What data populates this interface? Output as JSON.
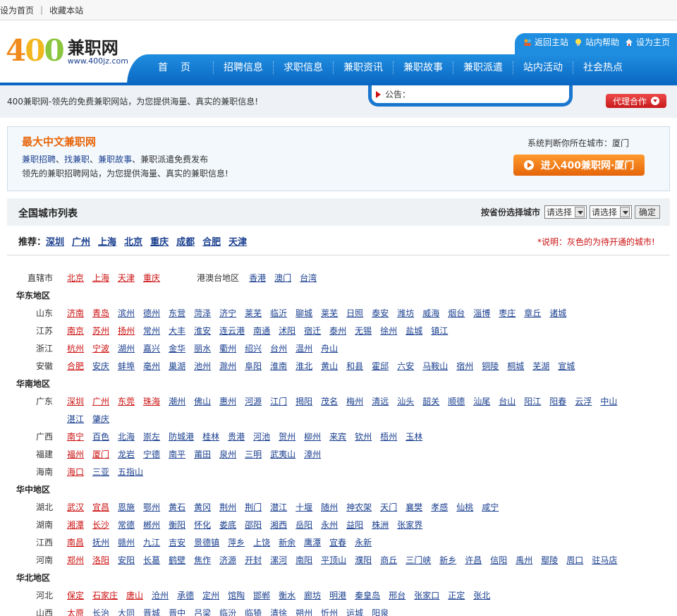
{
  "topbar": {
    "set_home": "设为首页",
    "favorite": "收藏本站"
  },
  "logo": {
    "num": "400",
    "cn": "兼职网",
    "url": "www.400jz.com"
  },
  "nav": [
    "首页",
    "招聘信息",
    "求职信息",
    "兼职资讯",
    "兼职故事",
    "兼职派遣",
    "站内活动",
    "社会热点"
  ],
  "tools": {
    "back": "返回主站",
    "help": "站内帮助",
    "home": "设为主页"
  },
  "subbar": {
    "slogan": "400兼职网-领先的免费兼职网站，为您提供海量、真实的兼职信息!",
    "notice_label": "公告：",
    "agent": "代理合作"
  },
  "info": {
    "title": "最大中文兼职网",
    "links": [
      "兼职招聘",
      "找兼职",
      "兼职故事"
    ],
    "line1_suffix": "、兼职派遣免费发布",
    "line2": "领先的兼职招聘网站，为您提供海量、真实的兼职信息!",
    "city_detect": "系统判断你所在城市：厦门",
    "enter": "进入400兼职网·厦门"
  },
  "listhead": {
    "title": "全国城市列表",
    "label": "按省份选择城市",
    "select1": "请选择",
    "select2": "请选择",
    "ok": "确定"
  },
  "recommend": {
    "label": "推荐：",
    "cities": [
      "深圳",
      "广州",
      "上海",
      "北京",
      "重庆",
      "成都",
      "合肥",
      "天津"
    ]
  },
  "note": "*说明：灰色的为待开通的城市!",
  "direct": {
    "label": "直辖市",
    "cities": [
      "北京",
      "上海",
      "天津",
      "重庆"
    ],
    "gat_label": "港澳台地区",
    "gat": [
      "香港",
      "澳门",
      "台湾"
    ]
  },
  "regions": {
    "east": "华东地区",
    "south": "华南地区",
    "central": "华中地区",
    "north": "华北地区"
  },
  "provinces": {
    "shandong": {
      "name": "山东",
      "hot": [
        "济南",
        "青岛"
      ],
      "cities": [
        "滨州",
        "德州",
        "东营",
        "菏泽",
        "济宁",
        "莱芜",
        "临沂",
        "聊城",
        "莱芜",
        "日照",
        "泰安",
        "潍坊",
        "威海",
        "烟台",
        "淄博",
        "枣庄",
        "章丘",
        "诸城"
      ]
    },
    "jiangsu": {
      "name": "江苏",
      "hot": [
        "南京",
        "苏州",
        "扬州"
      ],
      "cities": [
        "常州",
        "大丰",
        "淮安",
        "连云港",
        "南通",
        "沭阳",
        "宿迁",
        "泰州",
        "无锡",
        "徐州",
        "盐城",
        "镇江"
      ]
    },
    "zhejiang": {
      "name": "浙江",
      "hot": [
        "杭州",
        "宁波"
      ],
      "cities": [
        "湖州",
        "嘉兴",
        "金华",
        "丽水",
        "衢州",
        "绍兴",
        "台州",
        "温州",
        "舟山"
      ]
    },
    "anhui": {
      "name": "安徽",
      "hot": [
        "合肥"
      ],
      "cities": [
        "安庆",
        "蚌埠",
        "亳州",
        "巢湖",
        "池州",
        "滁州",
        "阜阳",
        "淮南",
        "淮北",
        "黄山",
        "和县",
        "霍邱",
        "六安",
        "马鞍山",
        "宿州",
        "铜陵",
        "桐城",
        "芜湖",
        "宣城"
      ]
    },
    "guangdong": {
      "name": "广东",
      "hot": [
        "深圳",
        "广州",
        "东莞",
        "珠海"
      ],
      "cities": [
        "潮州",
        "佛山",
        "惠州",
        "河源",
        "江门",
        "揭阳",
        "茂名",
        "梅州",
        "清远",
        "汕头",
        "韶关",
        "顺德",
        "汕尾",
        "台山",
        "阳江",
        "阳春",
        "云浮",
        "中山"
      ],
      "cities2": [
        "湛江",
        "肇庆"
      ]
    },
    "guangxi": {
      "name": "广西",
      "hot": [
        "南宁"
      ],
      "cities": [
        "百色",
        "北海",
        "崇左",
        "防城港",
        "桂林",
        "贵港",
        "河池",
        "贺州",
        "柳州",
        "来宾",
        "钦州",
        "梧州",
        "玉林"
      ]
    },
    "fujian": {
      "name": "福建",
      "hot": [
        "福州",
        "厦门"
      ],
      "cities": [
        "龙岩",
        "宁德",
        "南平",
        "莆田",
        "泉州",
        "三明",
        "武夷山",
        "漳州"
      ]
    },
    "hainan": {
      "name": "海南",
      "hot": [
        "海口"
      ],
      "cities": [
        "三亚",
        "五指山"
      ]
    },
    "hubei": {
      "name": "湖北",
      "hot": [
        "武汉",
        "宜昌"
      ],
      "cities": [
        "恩施",
        "鄂州",
        "黄石",
        "黄冈",
        "荆州",
        "荆门",
        "潜江",
        "十堰",
        "随州",
        "神农架",
        "天门",
        "襄樊",
        "孝感",
        "仙桃",
        "咸宁"
      ]
    },
    "hunan": {
      "name": "湖南",
      "hot": [
        "湘潭",
        "长沙"
      ],
      "cities": [
        "常德",
        "郴州",
        "衡阳",
        "怀化",
        "娄底",
        "邵阳",
        "湘西",
        "岳阳",
        "永州",
        "益阳",
        "株洲",
        "张家界"
      ]
    },
    "jiangxi": {
      "name": "江西",
      "hot": [
        "南昌"
      ],
      "cities": [
        "抚州",
        "赣州",
        "九江",
        "吉安",
        "景德镇",
        "萍乡",
        "上饶",
        "新余",
        "鹰潭",
        "宜春",
        "永新"
      ]
    },
    "henan": {
      "name": "河南",
      "hot": [
        "郑州",
        "洛阳"
      ],
      "cities": [
        "安阳",
        "长葛",
        "鹤壁",
        "焦作",
        "济源",
        "开封",
        "漯河",
        "南阳",
        "平顶山",
        "濮阳",
        "商丘",
        "三门峡",
        "新乡",
        "许昌",
        "信阳",
        "禹州",
        "鄢陵",
        "周口",
        "驻马店"
      ]
    },
    "hebei": {
      "name": "河北",
      "hot": [
        "保定",
        "石家庄",
        "唐山"
      ],
      "cities": [
        "沧州",
        "承德",
        "定州",
        "馆陶",
        "邯郸",
        "衡水",
        "廊坊",
        "明港",
        "秦皇岛",
        "邢台",
        "张家口",
        "正定",
        "张北"
      ]
    },
    "shanxi": {
      "name": "山西",
      "hot": [
        "太原"
      ],
      "cities": [
        "长治",
        "大同",
        "晋城",
        "晋中",
        "吕梁",
        "临汾",
        "临猗",
        "清徐",
        "朔州",
        "忻州",
        "运城",
        "阳泉"
      ]
    }
  }
}
